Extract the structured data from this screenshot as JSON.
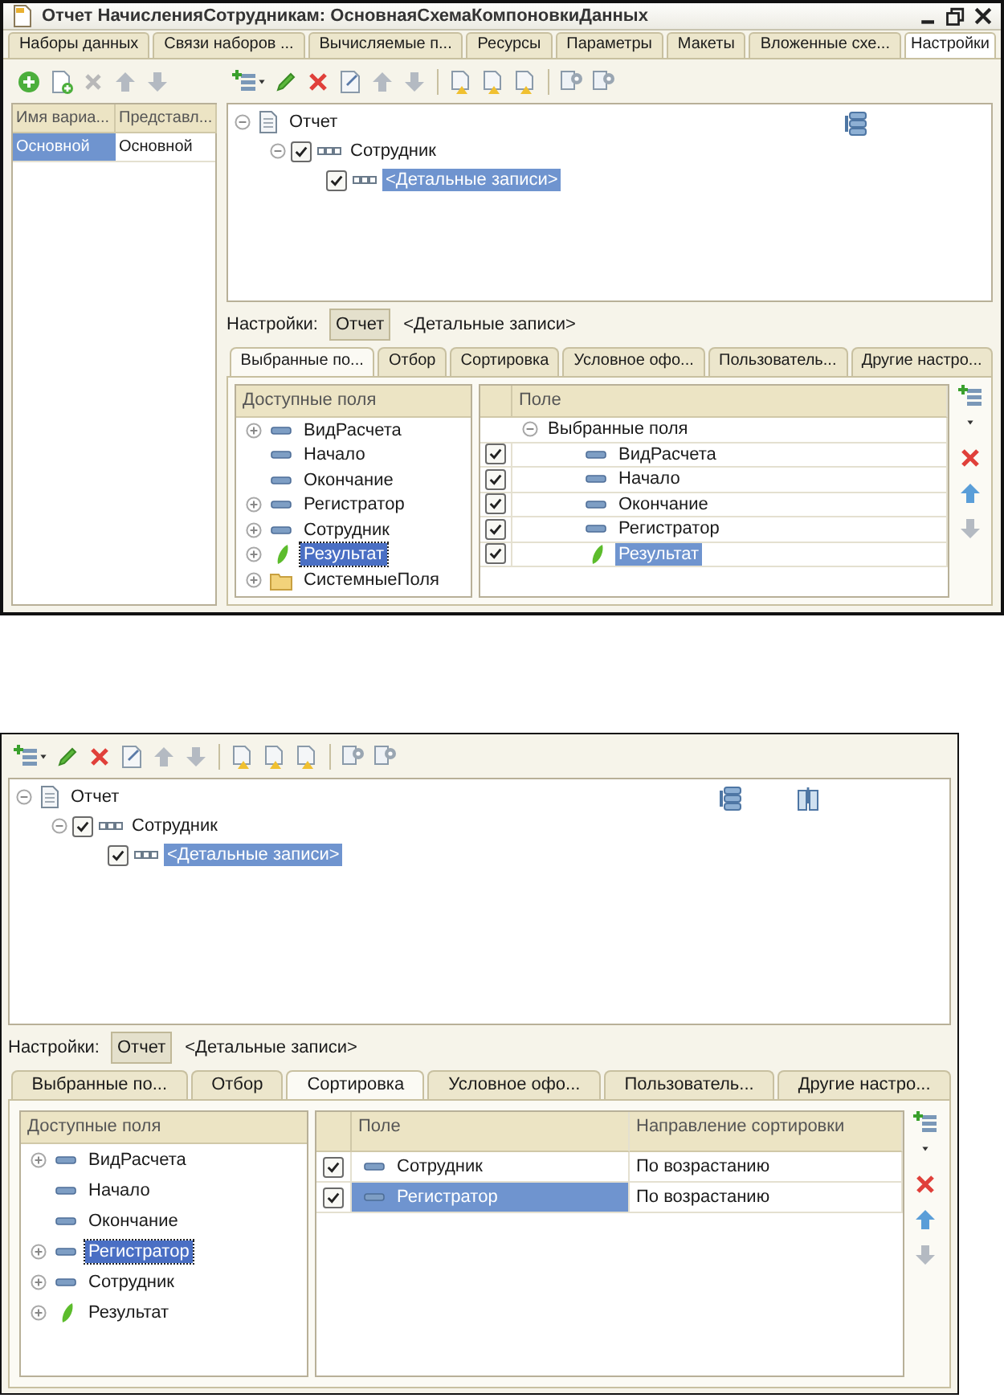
{
  "window": {
    "title": "Отчет НачисленияСотрудникам: ОсновнаяСхемаКомпоновкиДанных",
    "tabs": [
      {
        "label": "Наборы данных",
        "selected": false
      },
      {
        "label": "Связи наборов ...",
        "selected": false
      },
      {
        "label": "Вычисляемые п...",
        "selected": false
      },
      {
        "label": "Ресурсы",
        "selected": false
      },
      {
        "label": "Параметры",
        "selected": false
      },
      {
        "label": "Макеты",
        "selected": false
      },
      {
        "label": "Вложенные схе...",
        "selected": false
      },
      {
        "label": "Настройки",
        "selected": true
      }
    ]
  },
  "variants": {
    "columns": [
      "Имя вариа...",
      "Представл..."
    ],
    "rows": [
      {
        "cells": [
          "Основной",
          "Основной"
        ],
        "selected": true
      }
    ]
  },
  "editors": [
    {
      "tree": [
        {
          "kind": "report",
          "label": "Отчет",
          "expanded": true,
          "selected": false,
          "children": [
            {
              "kind": "group",
              "label": "Сотрудник",
              "expanded": true,
              "checked": true,
              "selected": false,
              "children": [
                {
                  "kind": "details",
                  "label": "<Детальные записи>",
                  "checked": true,
                  "selected": true
                }
              ]
            }
          ]
        }
      ],
      "settings": {
        "label": "Настройки:",
        "items": [
          {
            "label": "Отчет",
            "selected": true
          },
          {
            "label": "<Детальные записи>",
            "selected": false
          }
        ]
      },
      "tabs": [
        {
          "label": "Выбранные по...",
          "selected": true
        },
        {
          "label": "Отбор",
          "selected": false
        },
        {
          "label": "Сортировка",
          "selected": false
        },
        {
          "label": "Условное офо...",
          "selected": false
        },
        {
          "label": "Пользователь...",
          "selected": false
        },
        {
          "label": "Другие настро...",
          "selected": false
        }
      ],
      "available": {
        "header": "Доступные поля",
        "items": [
          {
            "kind": "field",
            "label": "ВидРасчета",
            "expanded": false,
            "selected": false
          },
          {
            "kind": "field",
            "label": "Начало",
            "selected": false
          },
          {
            "kind": "field",
            "label": "Окончание",
            "selected": false
          },
          {
            "kind": "field",
            "label": "Регистратор",
            "expanded": false,
            "selected": false
          },
          {
            "kind": "field",
            "label": "Сотрудник",
            "expanded": false,
            "selected": false
          },
          {
            "kind": "resource",
            "label": "Результат",
            "expanded": false,
            "selected": true
          },
          {
            "kind": "folder",
            "label": "СистемныеПоля",
            "expanded": false,
            "selected": false
          }
        ]
      },
      "chosen": {
        "columns": [
          "Поле"
        ],
        "rows": [
          {
            "kind": "group",
            "label": "Выбранные поля",
            "expanded": true,
            "children": [
              {
                "kind": "field",
                "label": "ВидРасчета",
                "checked": true,
                "selected": false
              },
              {
                "kind": "field",
                "label": "Начало",
                "checked": true,
                "selected": false
              },
              {
                "kind": "field",
                "label": "Окончание",
                "checked": true,
                "selected": false
              },
              {
                "kind": "field",
                "label": "Регистратор",
                "checked": true,
                "selected": false
              },
              {
                "kind": "resource",
                "label": "Результат",
                "checked": true,
                "selected": true
              }
            ]
          }
        ]
      }
    },
    {
      "tree": [
        {
          "kind": "report",
          "label": "Отчет",
          "expanded": true,
          "selected": false,
          "children": [
            {
              "kind": "group",
              "label": "Сотрудник",
              "expanded": true,
              "checked": true,
              "selected": false,
              "children": [
                {
                  "kind": "details",
                  "label": "<Детальные записи>",
                  "checked": true,
                  "selected": true
                }
              ]
            }
          ]
        }
      ],
      "settings": {
        "label": "Настройки:",
        "items": [
          {
            "label": "Отчет",
            "selected": true
          },
          {
            "label": "<Детальные записи>",
            "selected": false
          }
        ]
      },
      "tabs": [
        {
          "label": "Выбранные по...",
          "selected": false
        },
        {
          "label": "Отбор",
          "selected": false
        },
        {
          "label": "Сортировка",
          "selected": true
        },
        {
          "label": "Условное офо...",
          "selected": false
        },
        {
          "label": "Пользователь...",
          "selected": false
        },
        {
          "label": "Другие настро...",
          "selected": false
        }
      ],
      "available": {
        "header": "Доступные поля",
        "items": [
          {
            "kind": "field",
            "label": "ВидРасчета",
            "expanded": false,
            "selected": false
          },
          {
            "kind": "field",
            "label": "Начало",
            "selected": false
          },
          {
            "kind": "field",
            "label": "Окончание",
            "selected": false
          },
          {
            "kind": "field",
            "label": "Регистратор",
            "expanded": false,
            "selected": true
          },
          {
            "kind": "field",
            "label": "Сотрудник",
            "expanded": false,
            "selected": false
          },
          {
            "kind": "resource",
            "label": "Результат",
            "expanded": false,
            "selected": false
          }
        ]
      },
      "chosen": {
        "columns": [
          "Поле",
          "Направление сортировки"
        ],
        "rows": [
          {
            "kind": "field",
            "label": "Сотрудник",
            "checked": true,
            "selected": false,
            "direction": "По возрастанию"
          },
          {
            "kind": "field",
            "label": "Регистратор",
            "checked": true,
            "selected": true,
            "direction": "По возрастанию"
          }
        ]
      }
    }
  ]
}
